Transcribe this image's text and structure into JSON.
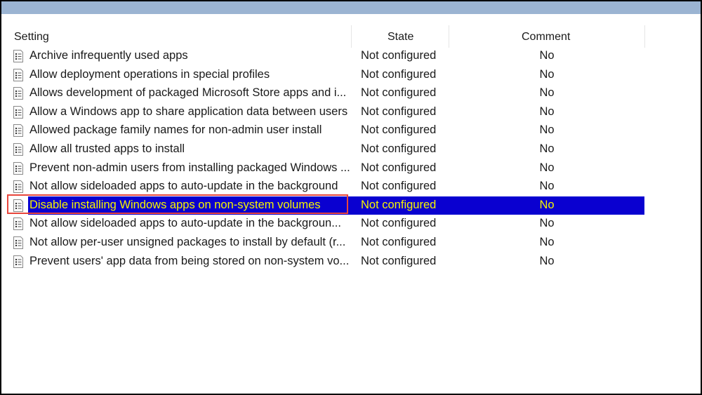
{
  "columns": {
    "setting": "Setting",
    "state": "State",
    "comment": "Comment"
  },
  "rows": [
    {
      "name": "Archive infrequently used apps",
      "state": "Not configured",
      "comment": "No"
    },
    {
      "name": "Allow deployment operations in special profiles",
      "state": "Not configured",
      "comment": "No"
    },
    {
      "name": "Allows development of packaged Microsoft Store apps and i...",
      "state": "Not configured",
      "comment": "No"
    },
    {
      "name": "Allow a Windows app to share application data between users",
      "state": "Not configured",
      "comment": "No"
    },
    {
      "name": "Allowed package family names for non-admin user install",
      "state": "Not configured",
      "comment": "No"
    },
    {
      "name": "Allow all trusted apps to install",
      "state": "Not configured",
      "comment": "No"
    },
    {
      "name": "Prevent non-admin users from installing packaged Windows ...",
      "state": "Not configured",
      "comment": "No"
    },
    {
      "name": "Not allow sideloaded apps to auto-update in the background",
      "state": "Not configured",
      "comment": "No"
    },
    {
      "name": "Disable installing Windows apps on non-system volumes",
      "state": "Not configured",
      "comment": "No",
      "selected": true
    },
    {
      "name": "Not allow sideloaded apps to auto-update in the backgroun...",
      "state": "Not configured",
      "comment": "No"
    },
    {
      "name": "Not allow per-user unsigned packages to install by default (r...",
      "state": "Not configured",
      "comment": "No"
    },
    {
      "name": "Prevent users' app data from being stored on non-system vo...",
      "state": "Not configured",
      "comment": "No"
    }
  ],
  "colors": {
    "selection": "#0a00d0",
    "selected_text": "#f5f500",
    "highlight_box": "#e8463c",
    "title_band": "#9bb4d2"
  }
}
